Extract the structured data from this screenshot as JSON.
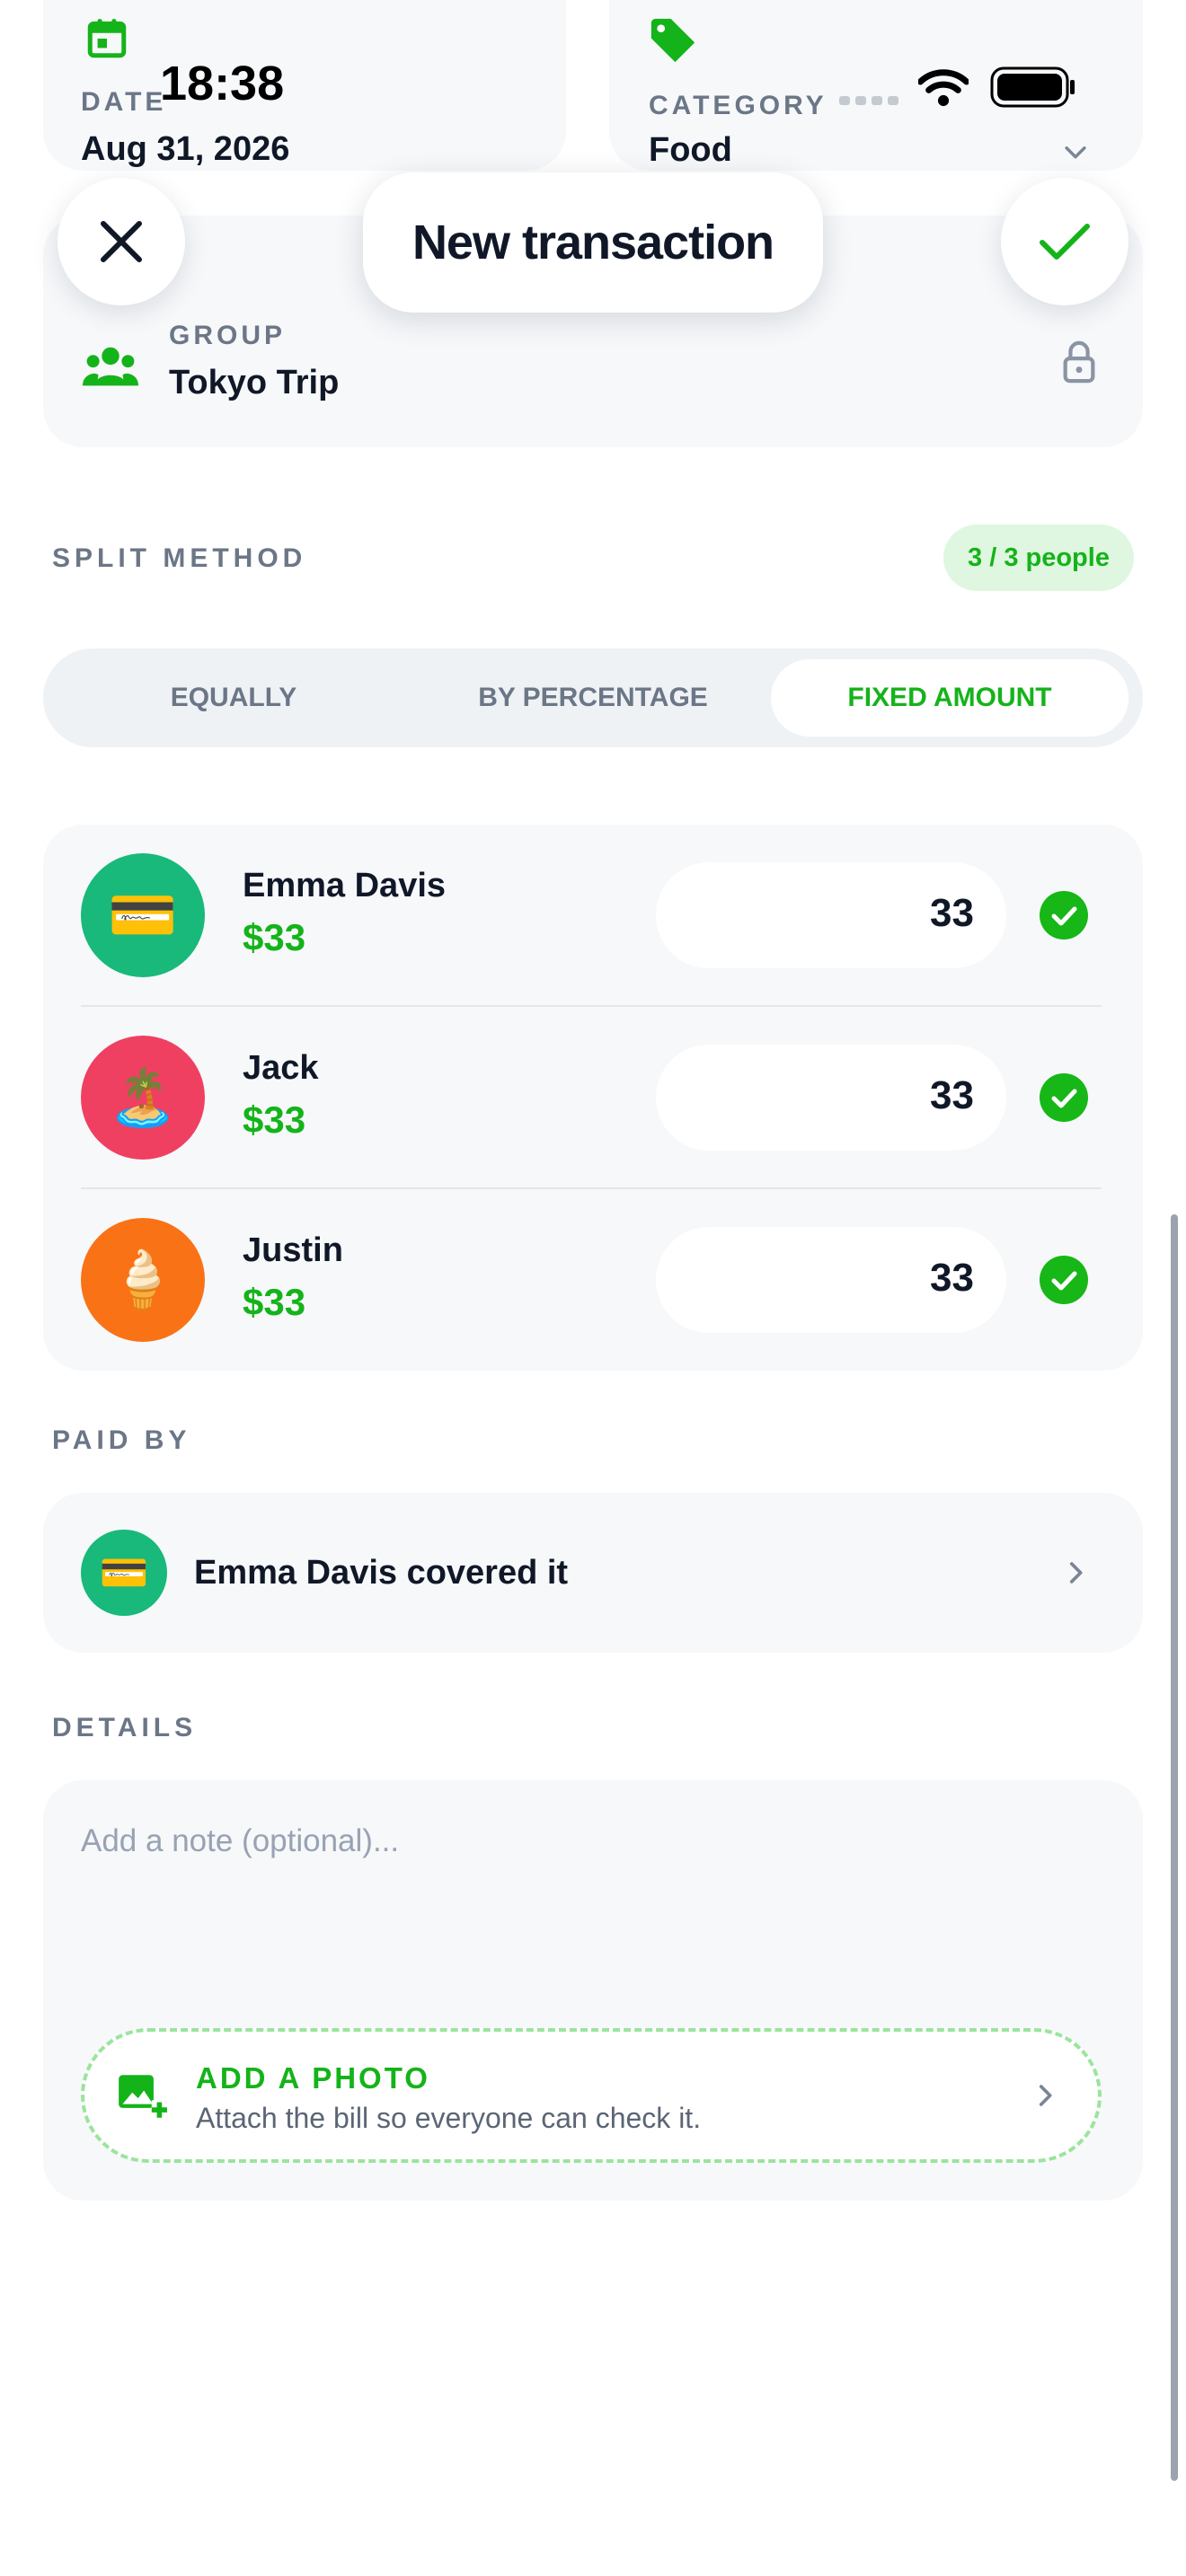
{
  "status_bar": {
    "time": "18:38"
  },
  "header": {
    "title": "New transaction",
    "close_icon": "close-icon",
    "confirm_icon": "checkmark-icon"
  },
  "date_card": {
    "label": "DATE",
    "value": "Aug 31, 2026",
    "icon": "calendar-icon"
  },
  "category_card": {
    "label": "CATEGORY",
    "value": "Food",
    "icon": "tag-icon"
  },
  "group_card": {
    "label": "GROUP",
    "value": "Tokyo Trip",
    "icon": "people-icon",
    "lock_icon": "lock-icon"
  },
  "split": {
    "section_label": "SPLIT METHOD",
    "people_badge": "3 / 3 people",
    "tabs": [
      {
        "label": "EQUALLY",
        "selected": false
      },
      {
        "label": "BY PERCENTAGE",
        "selected": false
      },
      {
        "label": "FIXED AMOUNT",
        "selected": true
      }
    ],
    "members": [
      {
        "name": "Emma Davis",
        "share": "$33",
        "amount": "33",
        "emoji": "💳",
        "color": "#18b97b"
      },
      {
        "name": "Jack",
        "share": "$33",
        "amount": "33",
        "emoji": "🏝️",
        "color": "#ef4062"
      },
      {
        "name": "Justin",
        "share": "$33",
        "amount": "33",
        "emoji": "🍦",
        "color": "#f97316"
      }
    ]
  },
  "paid_by": {
    "section_label": "PAID BY",
    "text": "Emma Davis covered it",
    "emoji": "💳"
  },
  "details": {
    "section_label": "DETAILS",
    "note_placeholder": "Add a note (optional)...",
    "photo_title": "ADD A PHOTO",
    "photo_subtitle": "Attach the bill so everyone can check it."
  },
  "colors": {
    "accent": "#15b31a",
    "card": "#f6f8fa",
    "label": "#6b7686"
  }
}
